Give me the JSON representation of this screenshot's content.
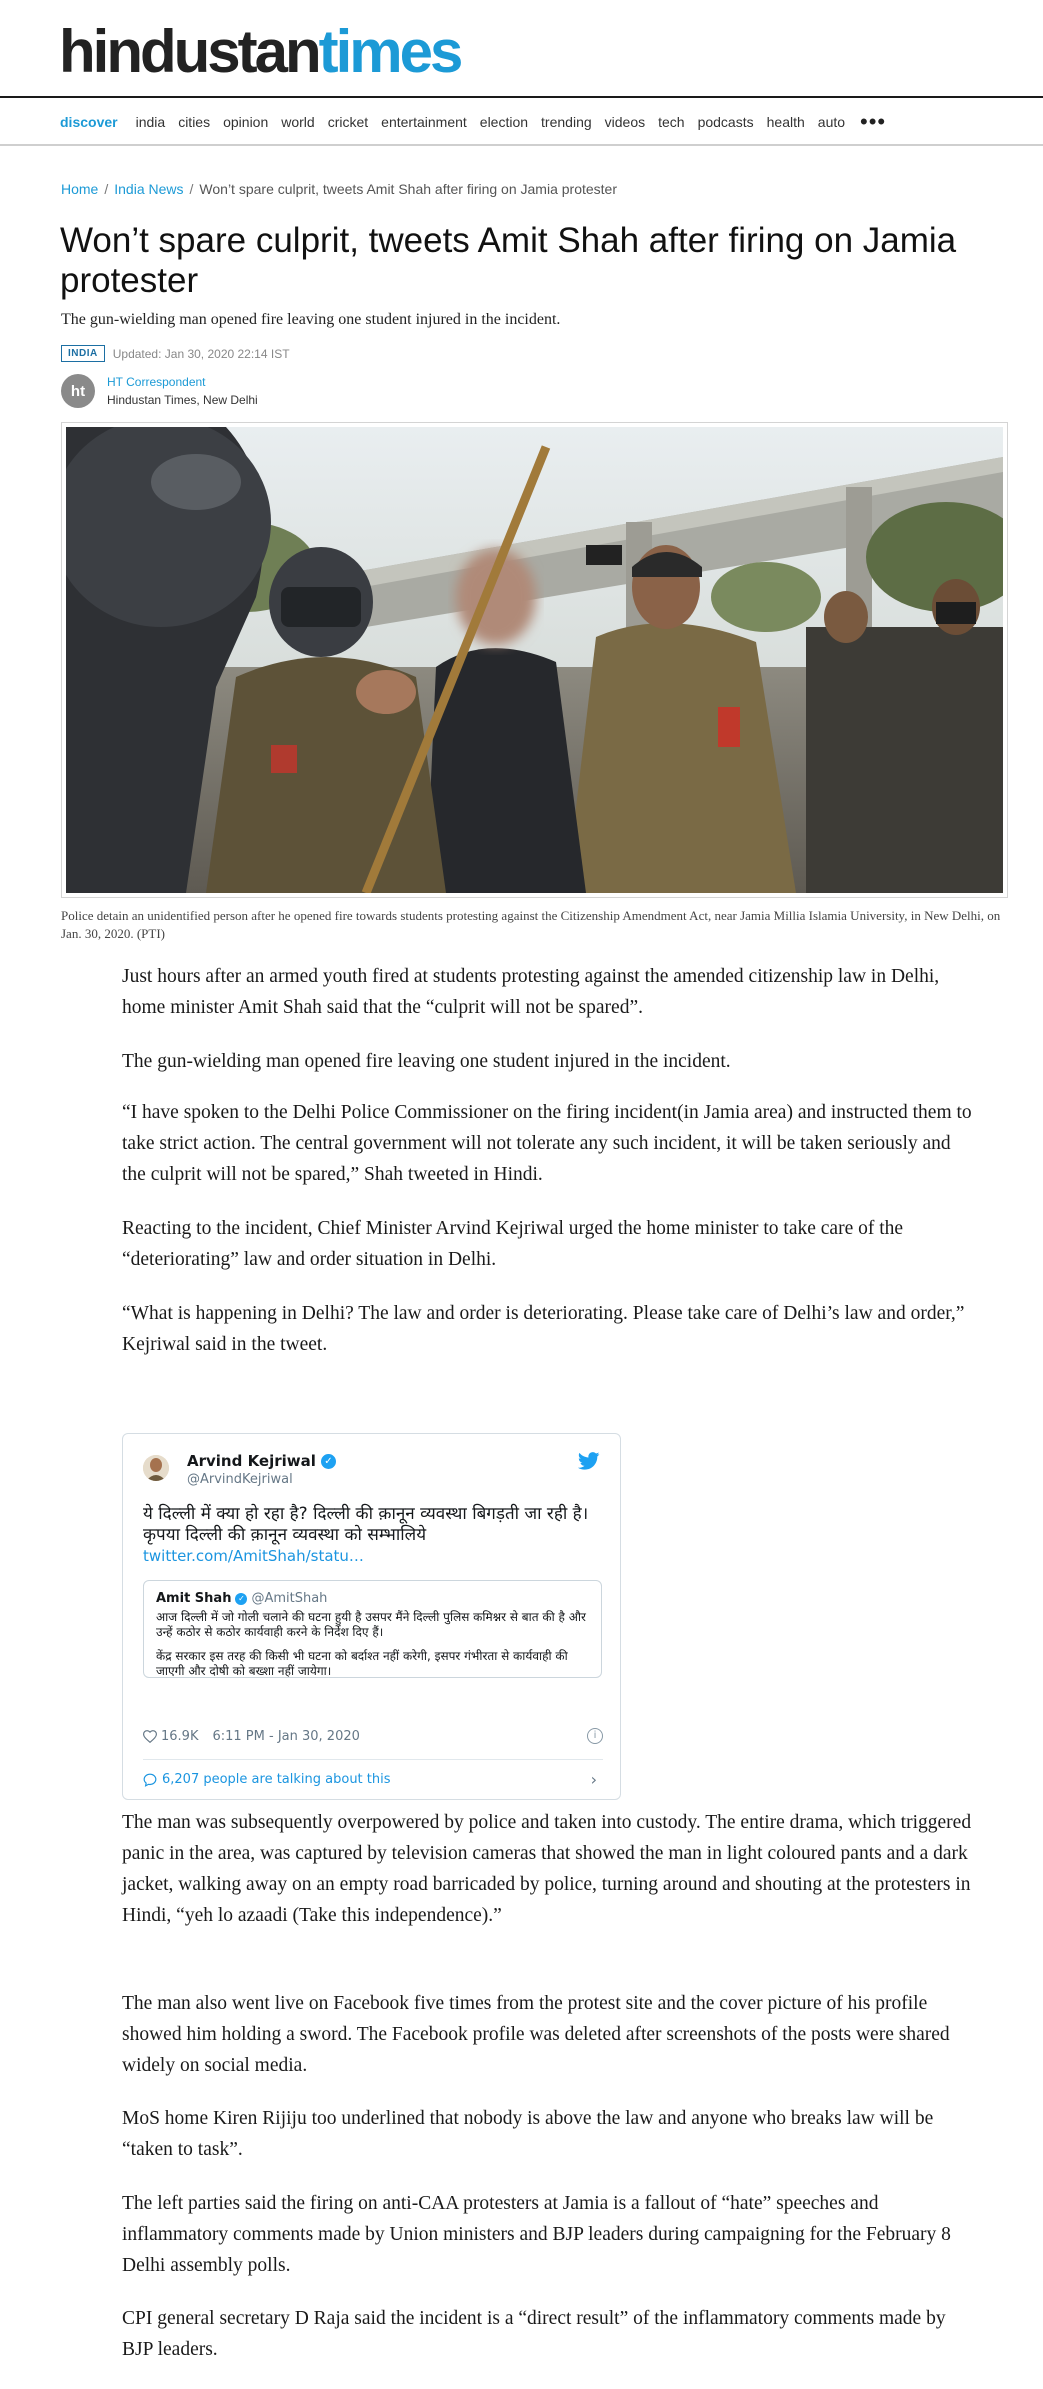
{
  "site": {
    "logo_part1": "hindustan",
    "logo_part2": "times"
  },
  "nav": {
    "discover": "discover",
    "items": [
      "india",
      "cities",
      "opinion",
      "world",
      "cricket",
      "entertainment",
      "election",
      "trending",
      "videos",
      "tech",
      "podcasts",
      "health",
      "auto"
    ],
    "more": "•••"
  },
  "breadcrumb": {
    "home": "Home",
    "section": "India News",
    "current": "Won’t spare culprit, tweets Amit Shah after firing on Jamia protester"
  },
  "article": {
    "headline": "Won’t spare culprit, tweets Amit Shah after firing on Jamia protester",
    "subhead": "The gun-wielding man opened fire leaving one student injured in the incident.",
    "tag": "INDIA",
    "updated": "Updated: Jan 30, 2020 22:14 IST",
    "author_initials": "ht",
    "author_name": "HT Correspondent",
    "author_location": "Hindustan Times, New Delhi",
    "caption": "Police detain an unidentified person after he opened fire towards students protesting against the Citizenship Amendment Act, near Jamia Millia Islamia University, in New Delhi, on Jan. 30, 2020. (PTI)",
    "paragraphs": [
      "Just hours after an armed youth fired at students protesting against the amended citizenship law in Delhi, home minister Amit Shah said that the “culprit will not be spared”.",
      "The gun-wielding man opened fire leaving one student injured in the incident.",
      "“I have spoken to the Delhi Police Commissioner on the firing incident(in Jamia area) and instructed them to take strict action. The central government will not tolerate any such incident, it will be taken seriously and the culprit will not be spared,” Shah tweeted in Hindi.",
      "Reacting to the incident, Chief Minister Arvind Kejriwal urged the home minister to take care of the “deteriorating” law and order situation in Delhi.",
      "“What is happening in Delhi? The law and order is deteriorating. Please take care of Delhi’s law and order,” Kejriwal said in the tweet.",
      "The man was subsequently overpowered by police and taken into custody. The entire drama, which triggered panic in the area, was captured by television cameras that showed the man in light coloured pants and a dark jacket, walking away on an empty road barricaded by police, turning around and shouting at the protesters in Hindi, “yeh lo azaadi (Take this independence).”",
      "The man also went live on Facebook five times from the protest site and the cover picture of his profile showed him holding a sword. The Facebook profile was deleted after screenshots of the posts were shared widely on social media.",
      "MoS home Kiren Rijiju too underlined that nobody is above the law and anyone who breaks law will be “taken to task”.",
      "The left parties said the firing on anti-CAA protesters at Jamia is a fallout of “hate” speeches and inflammatory comments made by Union ministers and BJP leaders during campaigning for the February 8 Delhi assembly polls.",
      "CPI general secretary D Raja said the incident is a “direct result” of the inflammatory comments made by BJP leaders."
    ]
  },
  "tweet": {
    "name": "Arvind Kejriwal",
    "handle": "@ArvindKejriwal",
    "text_line1": "ये दिल्ली में क्या हो रहा है? दिल्ली की क़ानून व्यवस्था बिगड़ती जा रही है।",
    "text_line2": "कृपया दिल्ली की क़ानून व्यवस्था को सम्भालिये",
    "link": "twitter.com/AmitShah/statu…",
    "quote_name": "Amit Shah",
    "quote_handle": "@AmitShah",
    "quote_p1": "आज दिल्ली में जो गोली चलाने की घटना हुयी है उसपर मैंने दिल्ली पुलिस कमिश्नर से बात की है और उन्हें कठोर से कठोर कार्यवाही करने के निर्देश दिए हैं।",
    "quote_p2": "केंद्र सरकार इस तरह की किसी भी घटना को बर्दाश्त नहीं करेगी, इसपर गंभीरता से कार्यवाही की जाएगी और दोषी को बख्शा नहीं जायेगा।",
    "likes": "16.9K",
    "time": "6:11 PM - Jan 30, 2020",
    "talking": "6,207 people are talking about this"
  },
  "colors": {
    "brand_blue": "#1c9ad6",
    "twitter_blue": "#1da1f2"
  }
}
